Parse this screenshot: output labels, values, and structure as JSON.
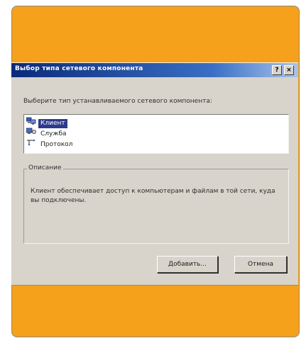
{
  "dialog": {
    "title": "Выбор типа сетевого компонента",
    "help_button": "?",
    "close_button": "×",
    "prompt": "Выберите тип устанавливаемого сетевого компонента:",
    "components": [
      {
        "label": "Клиент",
        "icon": "client-computers-icon",
        "selected": true
      },
      {
        "label": "Служба",
        "icon": "service-icon",
        "selected": false
      },
      {
        "label": "Протокол",
        "icon": "protocol-icon",
        "selected": false
      }
    ],
    "description_label": "Описание",
    "description_text": "Клиент обеспечивает доступ к компьютерам и файлам в той сети, куда вы подключены.",
    "add_button": "Добавить...",
    "cancel_button": "Отмена"
  },
  "colors": {
    "frame": "#f5a11c",
    "titlebar_start": "#0a2a7a",
    "titlebar_end": "#a8c4ec",
    "dialog_face": "#d8d4cc",
    "selection": "#2d3a8c"
  }
}
